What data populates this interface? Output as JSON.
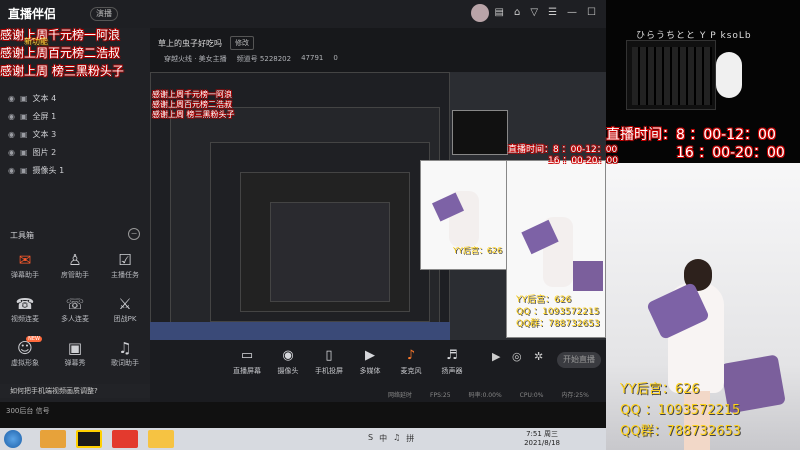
{
  "app": {
    "logo": "直播伴侣",
    "logo_mark": "YY",
    "mode_label": "演播",
    "room_title": "草上的虫子好吃吗",
    "edit_label": "修改",
    "room_info": [
      "穿越火线 · 美女主播",
      "频道号 5228202",
      "47791",
      "0"
    ],
    "window_icons": [
      "message",
      "shirt",
      "gift",
      "menu",
      "minimize",
      "close"
    ]
  },
  "overlay_lines": [
    "感谢上周千元榜一阿浪",
    "感谢上周百元榜二浩叔",
    "感谢上周    榜三黑粉头子"
  ],
  "overlay_badge": "新功能",
  "layers": [
    {
      "name": "文本 4"
    },
    {
      "name": "全屏 1"
    },
    {
      "name": "文本 3"
    },
    {
      "name": "图片 2"
    },
    {
      "name": "摄像头 1"
    }
  ],
  "tools": {
    "title": "工具箱",
    "items": [
      {
        "label": "弹幕助手",
        "icon": "✉",
        "accent": true,
        "badge": ""
      },
      {
        "label": "房管助手",
        "icon": "♙",
        "accent": false,
        "badge": ""
      },
      {
        "label": "主播任务",
        "icon": "☑",
        "accent": false,
        "badge": ""
      },
      {
        "label": "视频连麦",
        "icon": "☎",
        "accent": false,
        "badge": ""
      },
      {
        "label": "多人连麦",
        "icon": "☏",
        "accent": false,
        "badge": ""
      },
      {
        "label": "团战PK",
        "icon": "⚔",
        "accent": false,
        "badge": ""
      },
      {
        "label": "虚拟形象",
        "icon": "☺",
        "accent": false,
        "badge": "NEW"
      },
      {
        "label": "弹幕秀",
        "icon": "▣",
        "accent": false,
        "badge": ""
      },
      {
        "label": "歌词助手",
        "icon": "♫",
        "accent": false,
        "badge": ""
      },
      {
        "label": "PK",
        "icon": "⚑",
        "accent": true,
        "badge": ""
      },
      {
        "label": "",
        "icon": "♣",
        "accent": false,
        "badge": ""
      },
      {
        "label": "",
        "icon": "☗",
        "accent": true,
        "badge": ""
      }
    ]
  },
  "controls": [
    {
      "label": "直播屏幕",
      "icon": "▭"
    },
    {
      "label": "摄像头",
      "icon": "◉"
    },
    {
      "label": "手机投屏",
      "icon": "▯"
    },
    {
      "label": "多媒体",
      "icon": "▶"
    },
    {
      "label": "麦克风",
      "icon": "♪"
    },
    {
      "label": "扬声器",
      "icon": "♬"
    }
  ],
  "golive_label": "开始直播",
  "status": [
    "网络延时",
    "FPS:25",
    "码率:0.00%",
    "CPU:0%",
    "内存:25%"
  ],
  "notice": "如何把手机端视频画质调整?",
  "notice_detail": "300后台  信号",
  "camera": {
    "time_line1": "直播时间：8 ：00-12：00",
    "time_line2": "16 ：00-20：00",
    "wall_text": "ひらうちとと Y P ksoLb",
    "contact_line1": "YY后宫：626",
    "contact_line2": "QQ    ：1093572215",
    "contact_line3": "QQ群：788732653"
  },
  "taskbar": {
    "time": "7:51 周三",
    "date": "2021/8/18",
    "tray": [
      "S",
      "中",
      "♫",
      "拼"
    ]
  },
  "colors": {
    "accent": "#ff5a2b",
    "overlay_text": "#ffffff",
    "overlay_shadow": "#b10000",
    "yy_text": "#ffd21c"
  }
}
